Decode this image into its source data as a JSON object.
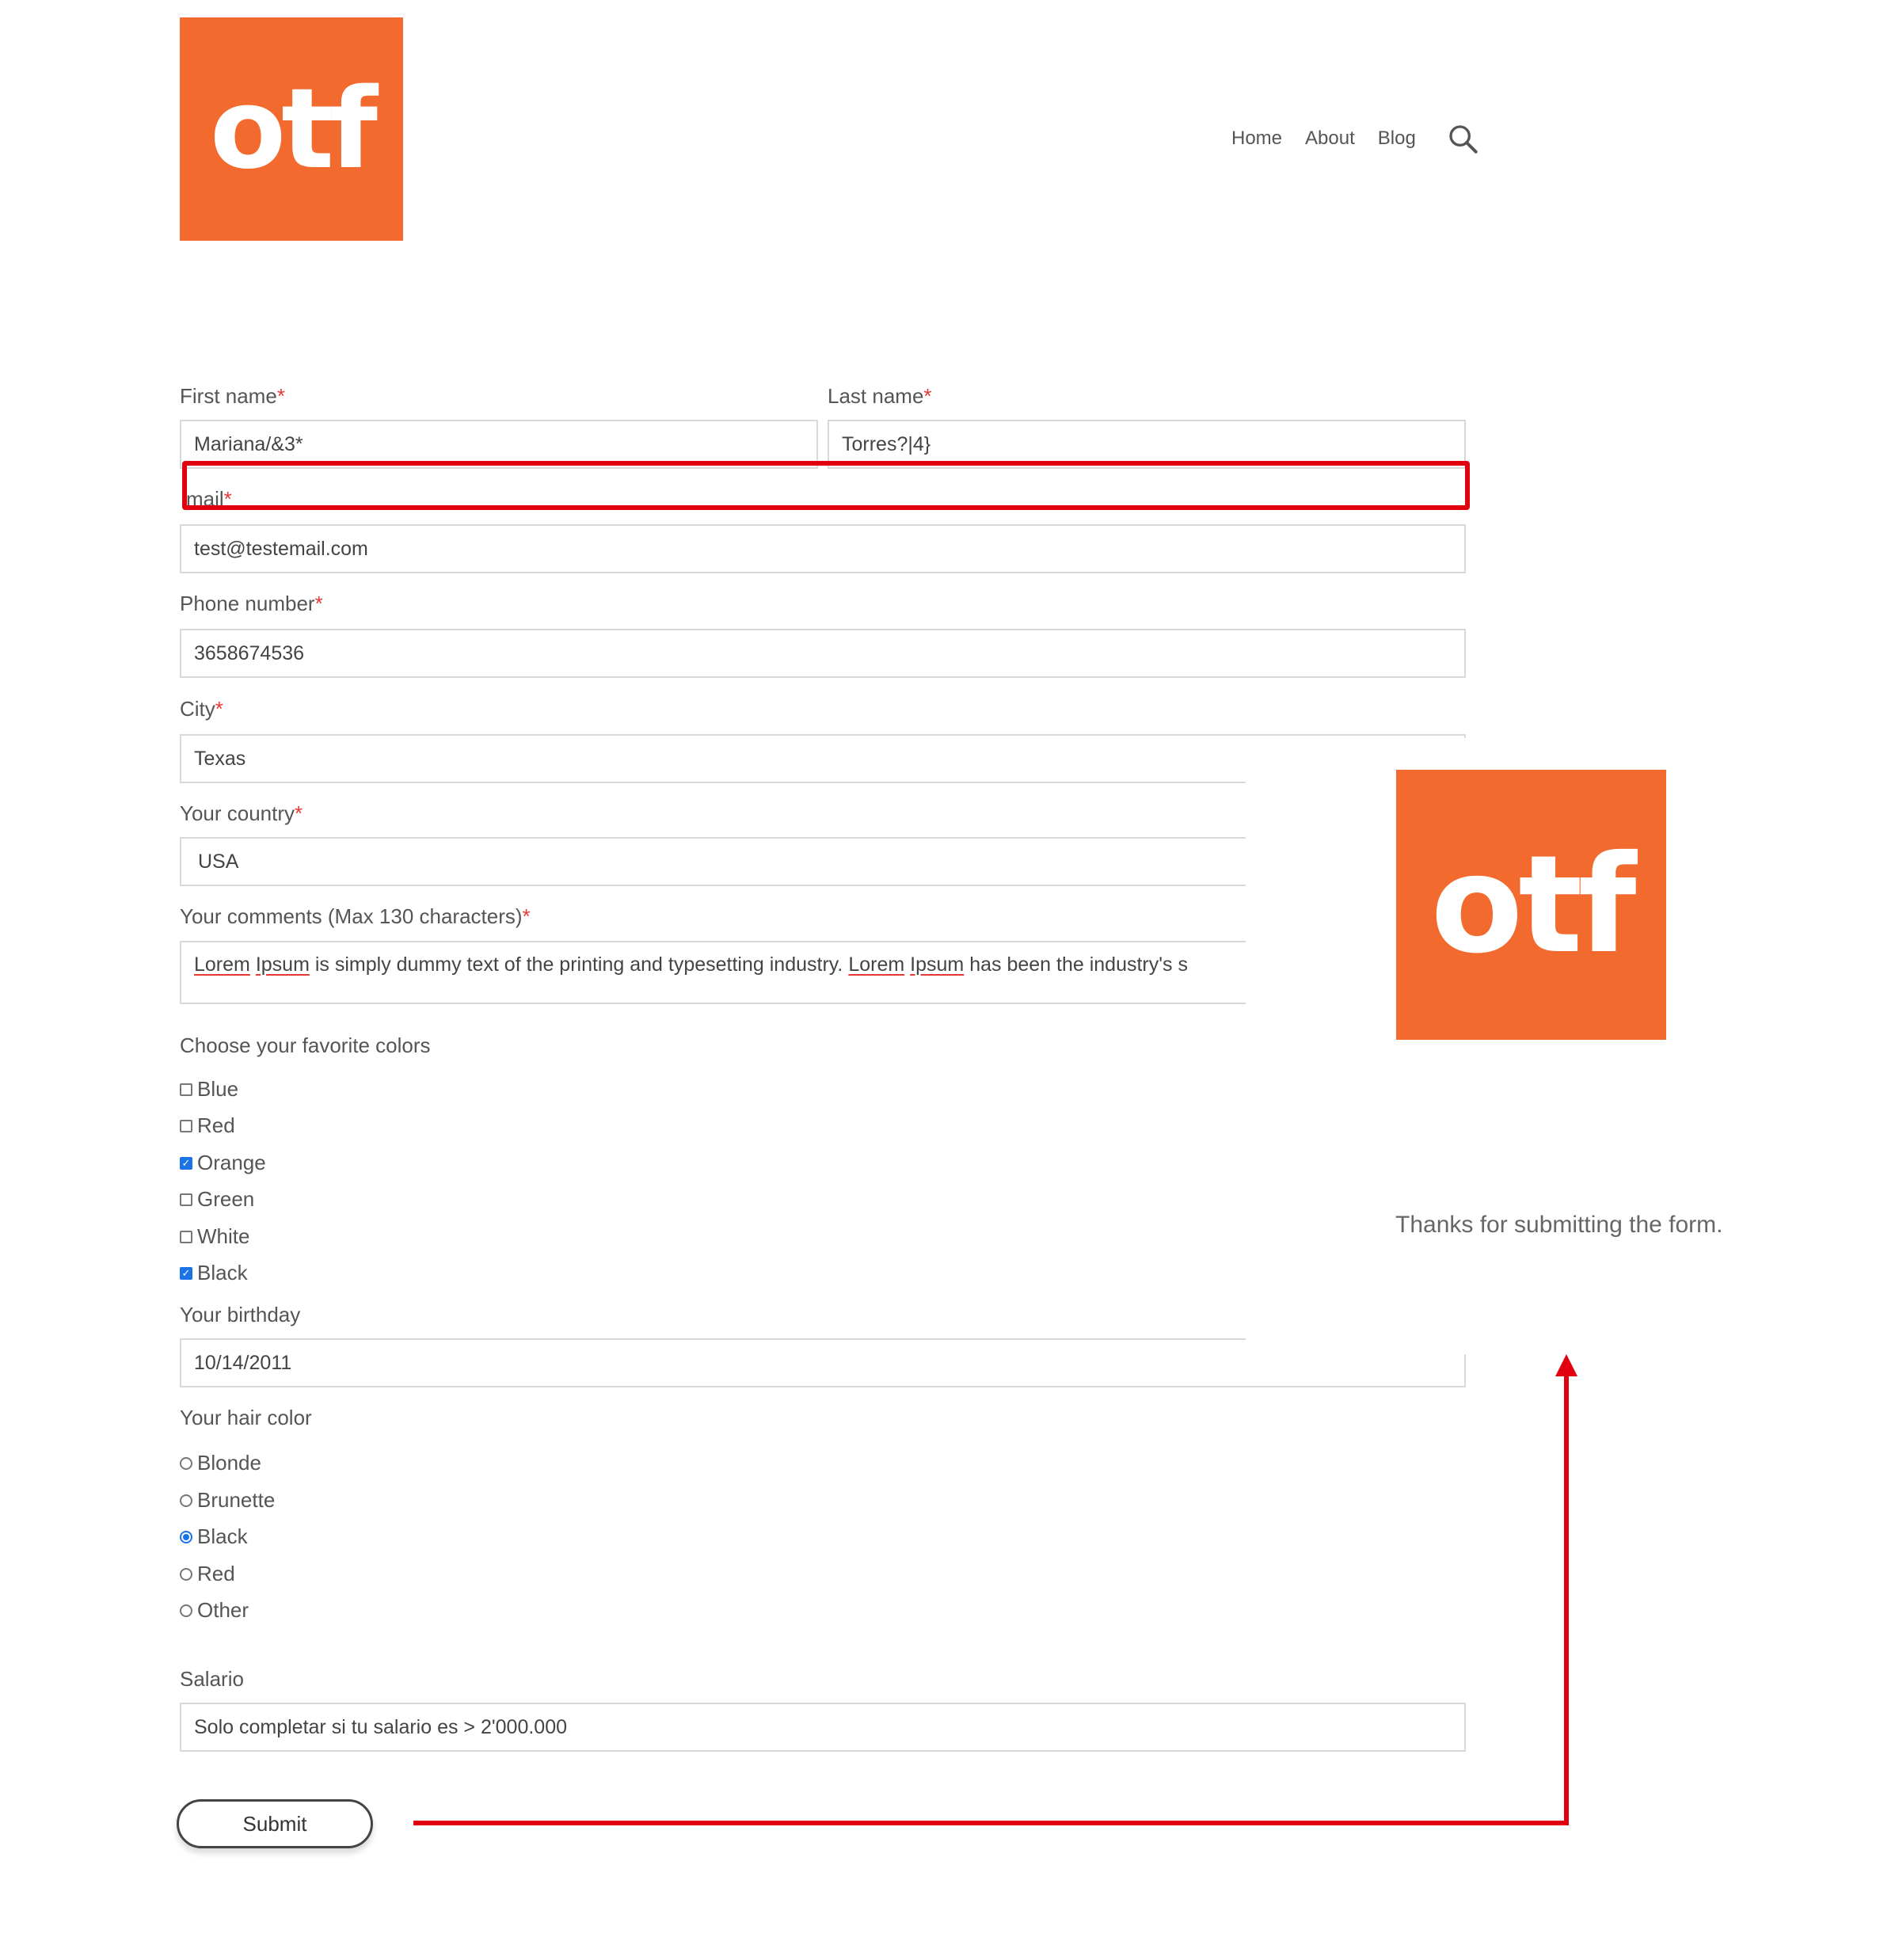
{
  "header": {
    "logo_text": "otf",
    "nav": [
      "Home",
      "About",
      "Blog"
    ],
    "search_icon": "search-icon"
  },
  "form": {
    "first_name": {
      "label": "First name",
      "value": "Mariana/&3*"
    },
    "last_name": {
      "label": "Last name",
      "value": "Torres?|4}"
    },
    "email": {
      "label": "mail",
      "value": "test@testemail.com"
    },
    "phone": {
      "label": "Phone number",
      "value": "3658674536"
    },
    "city": {
      "label": "City",
      "value": "Texas"
    },
    "country": {
      "label": "Your country",
      "value": "USA"
    },
    "comments": {
      "label": "Your comments (Max 130 characters)",
      "parts": [
        "Lorem",
        " ",
        "Ipsum",
        " is simply dummy text of the printing and typesetting industry. ",
        "Lorem",
        " ",
        "Ipsum",
        " has been the industry's s"
      ]
    },
    "colors": {
      "label": "Choose your favorite colors",
      "options": [
        {
          "label": "Blue",
          "checked": false
        },
        {
          "label": "Red",
          "checked": false
        },
        {
          "label": "Orange",
          "checked": true
        },
        {
          "label": "Green",
          "checked": false
        },
        {
          "label": "White",
          "checked": false
        },
        {
          "label": "Black",
          "checked": true
        }
      ]
    },
    "birthday": {
      "label": "Your birthday",
      "value": "10/14/2011"
    },
    "hair": {
      "label": "Your hair color",
      "options": [
        {
          "label": "Blonde",
          "checked": false
        },
        {
          "label": "Brunette",
          "checked": false
        },
        {
          "label": "Black",
          "checked": true
        },
        {
          "label": "Red",
          "checked": false
        },
        {
          "label": "Other",
          "checked": false
        }
      ]
    },
    "salario": {
      "label": "Salario",
      "placeholder": "Solo completar si tu salario es > 2'000.000"
    },
    "required_mark": "*",
    "submit_label": "Submit"
  },
  "popup": {
    "logo_text": "otf",
    "message": "Thanks for submitting the form."
  },
  "colors": {
    "brand": "#F26A2E",
    "annotation": "#e0000f",
    "checked": "#1a73e8"
  }
}
